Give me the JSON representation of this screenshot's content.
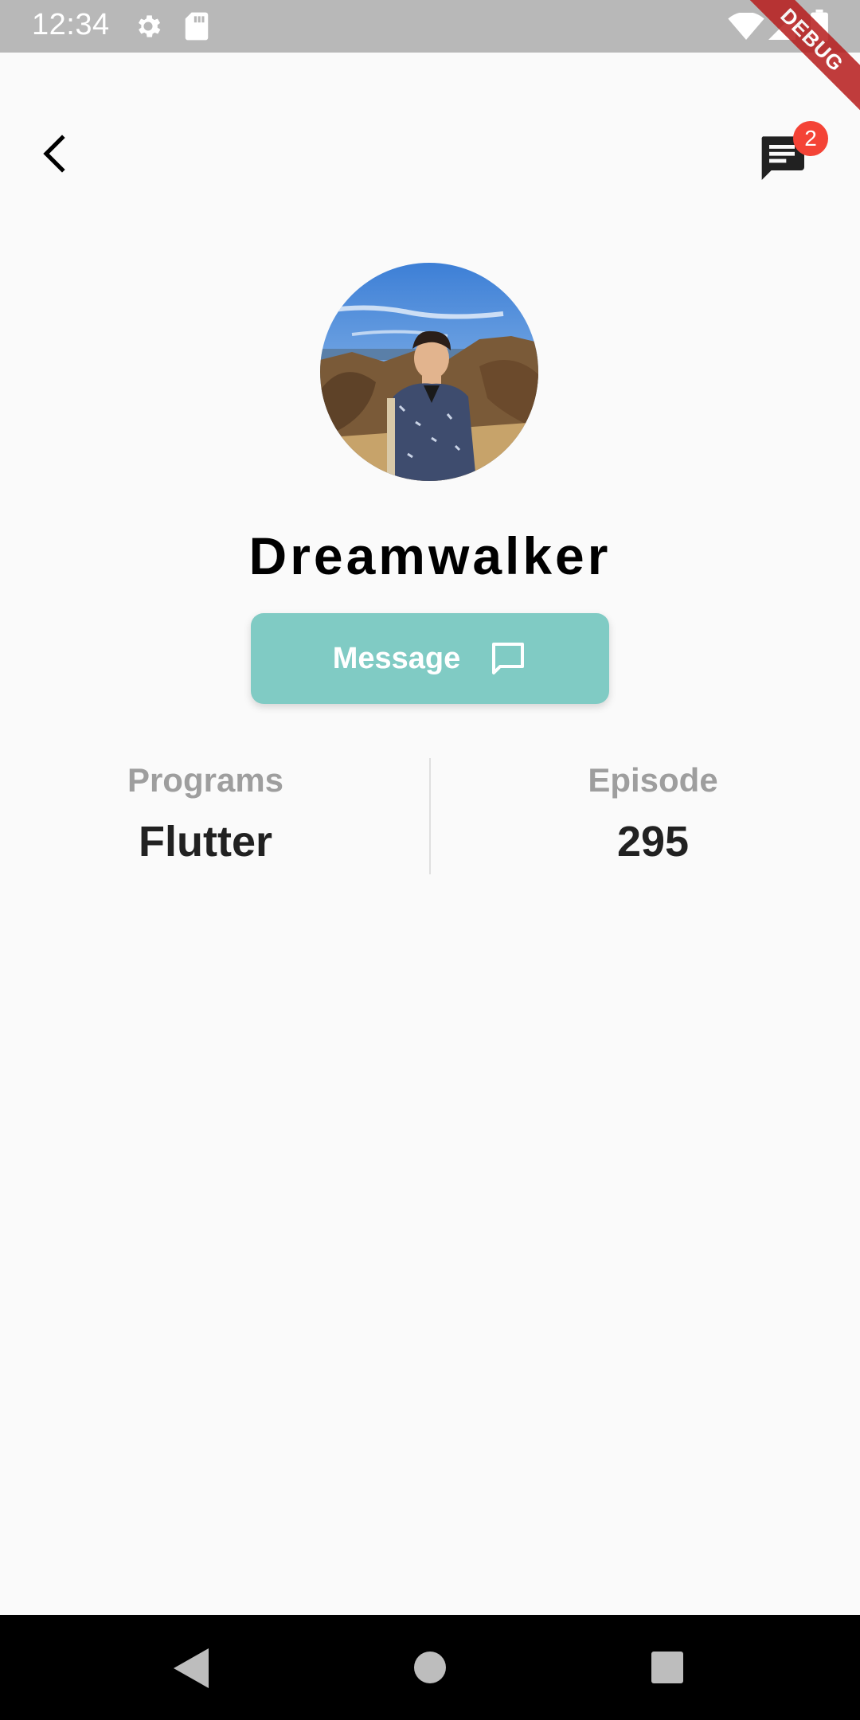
{
  "status_bar": {
    "time": "12:34",
    "debug_label": "DEBUG"
  },
  "header": {
    "back_icon": "back-arrow-icon",
    "chat_icon": "chat-icon",
    "badge_count": "2"
  },
  "profile": {
    "name": "Dreamwalker",
    "avatar_icon": "profile-photo"
  },
  "message_button": {
    "label": "Message",
    "icon": "chat-bubble-outline-icon"
  },
  "stats": {
    "programs": {
      "label": "Programs",
      "value": "Flutter"
    },
    "episode": {
      "label": "Episode",
      "value": "295"
    }
  },
  "colors": {
    "accent": "#80cbc4",
    "badge": "#f44336",
    "status_bar": "#b8b8b8",
    "muted_text": "#9e9e9e"
  }
}
